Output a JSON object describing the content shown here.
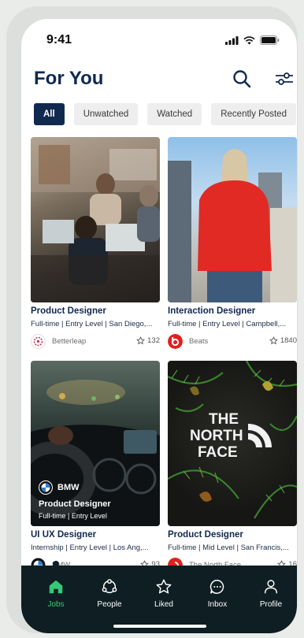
{
  "status_bar": {
    "time": "9:41"
  },
  "header": {
    "title": "For You"
  },
  "filters": [
    "All",
    "Unwatched",
    "Watched",
    "Recently Posted"
  ],
  "cards": [
    {
      "title": "Product Designer",
      "details": "Full-time | Entry Level | San Diego,...",
      "company": "Betterleap",
      "likes": "132"
    },
    {
      "title": "Interaction Designer",
      "details": "Full-time | Entry Level | Campbell,...",
      "company": "Beats",
      "likes": "1840"
    },
    {
      "title": "UI UX Designer",
      "details": "Internship | Entry Level | Los Ang,...",
      "company": "BMW",
      "likes": "93",
      "overlay": {
        "brand": "BMW",
        "title": "Product Designer",
        "details": "Full-time | Entry Level"
      }
    },
    {
      "title": "Product Designer",
      "details": "Full-time | Mid Level | San Francis,...",
      "company": "The North Face",
      "likes": "16",
      "image_text": [
        "THE",
        "NORTH",
        "FACE"
      ]
    }
  ],
  "nav": [
    "Jobs",
    "People",
    "Liked",
    "Inbox",
    "Profile"
  ],
  "colors": {
    "primary": "#10294f",
    "nav_bg": "#0e1e23",
    "active": "#37c776"
  }
}
